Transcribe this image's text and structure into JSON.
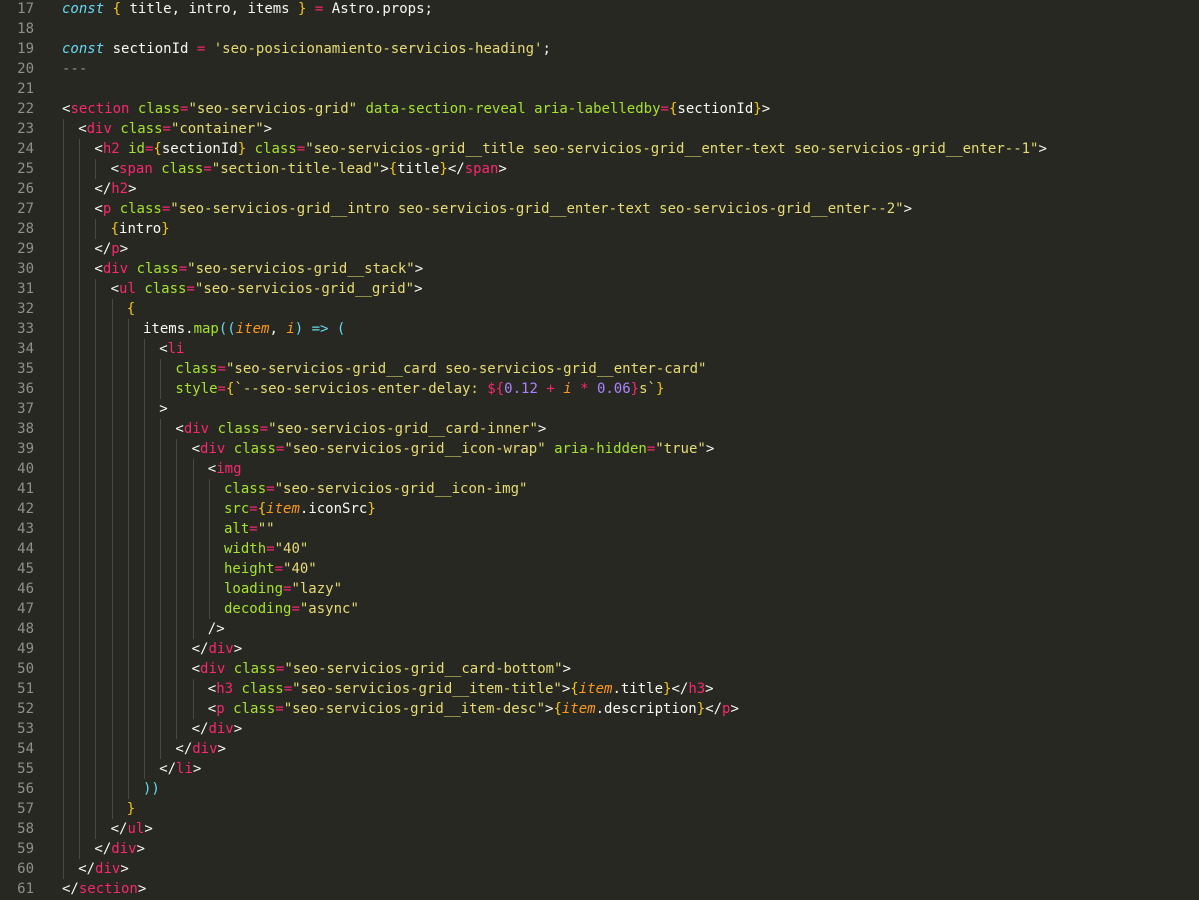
{
  "editor": {
    "language": "astro",
    "lines": [
      {
        "n": "17",
        "indent": 0,
        "tokens": [
          [
            "kw",
            "const"
          ],
          [
            "pun",
            " "
          ],
          [
            "brace",
            "{"
          ],
          [
            "pun",
            " title, intro, items "
          ],
          [
            "brace",
            "}"
          ],
          [
            "pun",
            " "
          ],
          [
            "op",
            "="
          ],
          [
            "pun",
            " Astro.props;"
          ]
        ]
      },
      {
        "n": "18",
        "indent": 0,
        "tokens": []
      },
      {
        "n": "19",
        "indent": 0,
        "tokens": [
          [
            "kw",
            "const"
          ],
          [
            "pun",
            " sectionId "
          ],
          [
            "op",
            "="
          ],
          [
            "pun",
            " "
          ],
          [
            "str",
            "'seo-posicionamiento-servicios-heading'"
          ],
          [
            "pun",
            ";"
          ]
        ]
      },
      {
        "n": "20",
        "indent": 0,
        "tokens": [
          [
            "dim",
            "---"
          ]
        ]
      },
      {
        "n": "21",
        "indent": 0,
        "tokens": []
      },
      {
        "n": "22",
        "indent": 0,
        "tokens": [
          [
            "pun",
            "<"
          ],
          [
            "tag",
            "section"
          ],
          [
            "pun",
            " "
          ],
          [
            "attr",
            "class"
          ],
          [
            "op",
            "="
          ],
          [
            "str",
            "\"seo-servicios-grid\""
          ],
          [
            "pun",
            " "
          ],
          [
            "attr",
            "data-section-reveal"
          ],
          [
            "pun",
            " "
          ],
          [
            "attr",
            "aria-labelledby"
          ],
          [
            "op",
            "="
          ],
          [
            "brace",
            "{"
          ],
          [
            "pun",
            "sectionId"
          ],
          [
            "brace",
            "}"
          ],
          [
            "pun",
            ">"
          ]
        ]
      },
      {
        "n": "23",
        "indent": 1,
        "tokens": [
          [
            "pun",
            "<"
          ],
          [
            "tag",
            "div"
          ],
          [
            "pun",
            " "
          ],
          [
            "attr",
            "class"
          ],
          [
            "op",
            "="
          ],
          [
            "str",
            "\"container\""
          ],
          [
            "pun",
            ">"
          ]
        ]
      },
      {
        "n": "24",
        "indent": 2,
        "tokens": [
          [
            "pun",
            "<"
          ],
          [
            "tag",
            "h2"
          ],
          [
            "pun",
            " "
          ],
          [
            "attr",
            "id"
          ],
          [
            "op",
            "="
          ],
          [
            "brace",
            "{"
          ],
          [
            "pun",
            "sectionId"
          ],
          [
            "brace",
            "}"
          ],
          [
            "pun",
            " "
          ],
          [
            "attr",
            "class"
          ],
          [
            "op",
            "="
          ],
          [
            "str",
            "\"seo-servicios-grid__title seo-servicios-grid__enter-text seo-servicios-grid__enter--1\""
          ],
          [
            "pun",
            ">"
          ]
        ]
      },
      {
        "n": "25",
        "indent": 3,
        "tokens": [
          [
            "pun",
            "<"
          ],
          [
            "tag",
            "span"
          ],
          [
            "pun",
            " "
          ],
          [
            "attr",
            "class"
          ],
          [
            "op",
            "="
          ],
          [
            "str",
            "\"section-title-lead\""
          ],
          [
            "pun",
            ">"
          ],
          [
            "brace",
            "{"
          ],
          [
            "pun",
            "title"
          ],
          [
            "brace",
            "}"
          ],
          [
            "pun",
            "</"
          ],
          [
            "tag",
            "span"
          ],
          [
            "pun",
            ">"
          ]
        ]
      },
      {
        "n": "26",
        "indent": 2,
        "tokens": [
          [
            "pun",
            "</"
          ],
          [
            "tag",
            "h2"
          ],
          [
            "pun",
            ">"
          ]
        ]
      },
      {
        "n": "27",
        "indent": 2,
        "tokens": [
          [
            "pun",
            "<"
          ],
          [
            "tag",
            "p"
          ],
          [
            "pun",
            " "
          ],
          [
            "attr",
            "class"
          ],
          [
            "op",
            "="
          ],
          [
            "str",
            "\"seo-servicios-grid__intro seo-servicios-grid__enter-text seo-servicios-grid__enter--2\""
          ],
          [
            "pun",
            ">"
          ]
        ]
      },
      {
        "n": "28",
        "indent": 3,
        "tokens": [
          [
            "brace",
            "{"
          ],
          [
            "pun",
            "intro"
          ],
          [
            "brace",
            "}"
          ]
        ]
      },
      {
        "n": "29",
        "indent": 2,
        "tokens": [
          [
            "pun",
            "</"
          ],
          [
            "tag",
            "p"
          ],
          [
            "pun",
            ">"
          ]
        ]
      },
      {
        "n": "30",
        "indent": 2,
        "tokens": [
          [
            "pun",
            "<"
          ],
          [
            "tag",
            "div"
          ],
          [
            "pun",
            " "
          ],
          [
            "attr",
            "class"
          ],
          [
            "op",
            "="
          ],
          [
            "str",
            "\"seo-servicios-grid__stack\""
          ],
          [
            "pun",
            ">"
          ]
        ]
      },
      {
        "n": "31",
        "indent": 3,
        "tokens": [
          [
            "pun",
            "<"
          ],
          [
            "tag",
            "ul"
          ],
          [
            "pun",
            " "
          ],
          [
            "attr",
            "class"
          ],
          [
            "op",
            "="
          ],
          [
            "str",
            "\"seo-servicios-grid__grid\""
          ],
          [
            "pun",
            ">"
          ]
        ]
      },
      {
        "n": "32",
        "indent": 4,
        "tokens": [
          [
            "brace",
            "{"
          ]
        ]
      },
      {
        "n": "33",
        "indent": 5,
        "tokens": [
          [
            "pun",
            "items."
          ],
          [
            "fn",
            "map"
          ],
          [
            "par",
            "(("
          ],
          [
            "var",
            "item"
          ],
          [
            "pun",
            ", "
          ],
          [
            "var",
            "i"
          ],
          [
            "par",
            ")"
          ],
          [
            "pun",
            " "
          ],
          [
            "kw",
            "=>"
          ],
          [
            "pun",
            " "
          ],
          [
            "par",
            "("
          ]
        ]
      },
      {
        "n": "34",
        "indent": 6,
        "tokens": [
          [
            "pun",
            "<"
          ],
          [
            "tag",
            "li"
          ]
        ]
      },
      {
        "n": "35",
        "indent": 7,
        "tokens": [
          [
            "attr",
            "class"
          ],
          [
            "op",
            "="
          ],
          [
            "str",
            "\"seo-servicios-grid__card seo-servicios-grid__enter-card\""
          ]
        ]
      },
      {
        "n": "36",
        "indent": 7,
        "tokens": [
          [
            "attr",
            "style"
          ],
          [
            "op",
            "="
          ],
          [
            "brace",
            "{"
          ],
          [
            "str",
            "`--seo-servicios-enter-delay: "
          ],
          [
            "op",
            "${"
          ],
          [
            "num",
            "0.12"
          ],
          [
            "pun",
            " "
          ],
          [
            "op",
            "+"
          ],
          [
            "pun",
            " "
          ],
          [
            "var",
            "i"
          ],
          [
            "pun",
            " "
          ],
          [
            "op",
            "*"
          ],
          [
            "pun",
            " "
          ],
          [
            "num",
            "0.06"
          ],
          [
            "op",
            "}"
          ],
          [
            "str",
            "s`"
          ],
          [
            "brace",
            "}"
          ]
        ]
      },
      {
        "n": "37",
        "indent": 6,
        "tokens": [
          [
            "pun",
            ">"
          ]
        ]
      },
      {
        "n": "38",
        "indent": 7,
        "tokens": [
          [
            "pun",
            "<"
          ],
          [
            "tag",
            "div"
          ],
          [
            "pun",
            " "
          ],
          [
            "attr",
            "class"
          ],
          [
            "op",
            "="
          ],
          [
            "str",
            "\"seo-servicios-grid__card-inner\""
          ],
          [
            "pun",
            ">"
          ]
        ]
      },
      {
        "n": "39",
        "indent": 8,
        "tokens": [
          [
            "pun",
            "<"
          ],
          [
            "tag",
            "div"
          ],
          [
            "pun",
            " "
          ],
          [
            "attr",
            "class"
          ],
          [
            "op",
            "="
          ],
          [
            "str",
            "\"seo-servicios-grid__icon-wrap\""
          ],
          [
            "pun",
            " "
          ],
          [
            "attr",
            "aria-hidden"
          ],
          [
            "op",
            "="
          ],
          [
            "str",
            "\"true\""
          ],
          [
            "pun",
            ">"
          ]
        ]
      },
      {
        "n": "40",
        "indent": 9,
        "tokens": [
          [
            "pun",
            "<"
          ],
          [
            "tag",
            "img"
          ]
        ]
      },
      {
        "n": "41",
        "indent": 10,
        "tokens": [
          [
            "attr",
            "class"
          ],
          [
            "op",
            "="
          ],
          [
            "str",
            "\"seo-servicios-grid__icon-img\""
          ]
        ]
      },
      {
        "n": "42",
        "indent": 10,
        "tokens": [
          [
            "attr",
            "src"
          ],
          [
            "op",
            "="
          ],
          [
            "brace",
            "{"
          ],
          [
            "var",
            "item"
          ],
          [
            "pun",
            ".iconSrc"
          ],
          [
            "brace",
            "}"
          ]
        ]
      },
      {
        "n": "43",
        "indent": 10,
        "tokens": [
          [
            "attr",
            "alt"
          ],
          [
            "op",
            "="
          ],
          [
            "str",
            "\"\""
          ]
        ]
      },
      {
        "n": "44",
        "indent": 10,
        "tokens": [
          [
            "attr",
            "width"
          ],
          [
            "op",
            "="
          ],
          [
            "str",
            "\"40\""
          ]
        ]
      },
      {
        "n": "45",
        "indent": 10,
        "tokens": [
          [
            "attr",
            "height"
          ],
          [
            "op",
            "="
          ],
          [
            "str",
            "\"40\""
          ]
        ]
      },
      {
        "n": "46",
        "indent": 10,
        "tokens": [
          [
            "attr",
            "loading"
          ],
          [
            "op",
            "="
          ],
          [
            "str",
            "\"lazy\""
          ]
        ]
      },
      {
        "n": "47",
        "indent": 10,
        "tokens": [
          [
            "attr",
            "decoding"
          ],
          [
            "op",
            "="
          ],
          [
            "str",
            "\"async\""
          ]
        ]
      },
      {
        "n": "48",
        "indent": 9,
        "tokens": [
          [
            "pun",
            "/>"
          ]
        ]
      },
      {
        "n": "49",
        "indent": 8,
        "tokens": [
          [
            "pun",
            "</"
          ],
          [
            "tag",
            "div"
          ],
          [
            "pun",
            ">"
          ]
        ]
      },
      {
        "n": "50",
        "indent": 8,
        "tokens": [
          [
            "pun",
            "<"
          ],
          [
            "tag",
            "div"
          ],
          [
            "pun",
            " "
          ],
          [
            "attr",
            "class"
          ],
          [
            "op",
            "="
          ],
          [
            "str",
            "\"seo-servicios-grid__card-bottom\""
          ],
          [
            "pun",
            ">"
          ]
        ]
      },
      {
        "n": "51",
        "indent": 9,
        "tokens": [
          [
            "pun",
            "<"
          ],
          [
            "tag",
            "h3"
          ],
          [
            "pun",
            " "
          ],
          [
            "attr",
            "class"
          ],
          [
            "op",
            "="
          ],
          [
            "str",
            "\"seo-servicios-grid__item-title\""
          ],
          [
            "pun",
            ">"
          ],
          [
            "brace",
            "{"
          ],
          [
            "var",
            "item"
          ],
          [
            "pun",
            ".title"
          ],
          [
            "brace",
            "}"
          ],
          [
            "pun",
            "</"
          ],
          [
            "tag",
            "h3"
          ],
          [
            "pun",
            ">"
          ]
        ]
      },
      {
        "n": "52",
        "indent": 9,
        "tokens": [
          [
            "pun",
            "<"
          ],
          [
            "tag",
            "p"
          ],
          [
            "pun",
            " "
          ],
          [
            "attr",
            "class"
          ],
          [
            "op",
            "="
          ],
          [
            "str",
            "\"seo-servicios-grid__item-desc\""
          ],
          [
            "pun",
            ">"
          ],
          [
            "brace",
            "{"
          ],
          [
            "var",
            "item"
          ],
          [
            "pun",
            ".description"
          ],
          [
            "brace",
            "}"
          ],
          [
            "pun",
            "</"
          ],
          [
            "tag",
            "p"
          ],
          [
            "pun",
            ">"
          ]
        ]
      },
      {
        "n": "53",
        "indent": 8,
        "tokens": [
          [
            "pun",
            "</"
          ],
          [
            "tag",
            "div"
          ],
          [
            "pun",
            ">"
          ]
        ]
      },
      {
        "n": "54",
        "indent": 7,
        "tokens": [
          [
            "pun",
            "</"
          ],
          [
            "tag",
            "div"
          ],
          [
            "pun",
            ">"
          ]
        ]
      },
      {
        "n": "55",
        "indent": 6,
        "tokens": [
          [
            "pun",
            "</"
          ],
          [
            "tag",
            "li"
          ],
          [
            "pun",
            ">"
          ]
        ]
      },
      {
        "n": "56",
        "indent": 5,
        "tokens": [
          [
            "par",
            "))"
          ]
        ]
      },
      {
        "n": "57",
        "indent": 4,
        "tokens": [
          [
            "brace",
            "}"
          ]
        ]
      },
      {
        "n": "58",
        "indent": 3,
        "tokens": [
          [
            "pun",
            "</"
          ],
          [
            "tag",
            "ul"
          ],
          [
            "pun",
            ">"
          ]
        ]
      },
      {
        "n": "59",
        "indent": 2,
        "tokens": [
          [
            "pun",
            "</"
          ],
          [
            "tag",
            "div"
          ],
          [
            "pun",
            ">"
          ]
        ]
      },
      {
        "n": "60",
        "indent": 1,
        "tokens": [
          [
            "pun",
            "</"
          ],
          [
            "tag",
            "div"
          ],
          [
            "pun",
            ">"
          ]
        ]
      },
      {
        "n": "61",
        "indent": 0,
        "tokens": [
          [
            "pun",
            "</"
          ],
          [
            "tag",
            "section"
          ],
          [
            "pun",
            ">"
          ]
        ]
      }
    ]
  }
}
